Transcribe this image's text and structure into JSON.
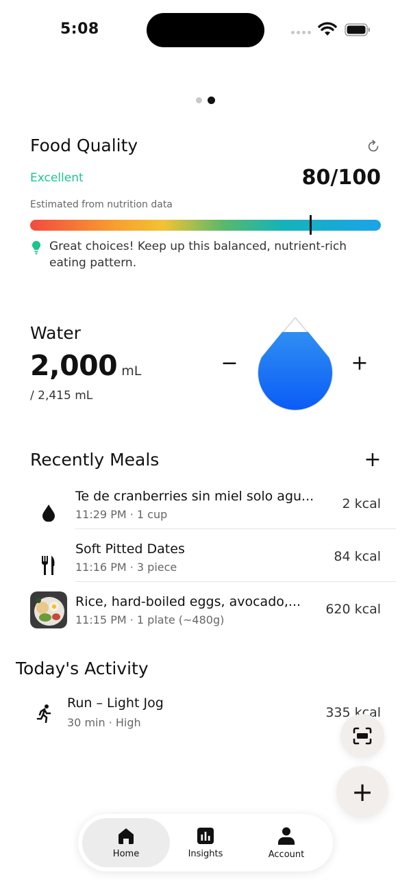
{
  "status": {
    "time": "5:08"
  },
  "food_quality": {
    "title": "Food Quality",
    "rating": "Excellent",
    "score": "80/100",
    "score_value": 80,
    "subtitle": "Estimated from nutrition data",
    "tip": "Great choices! Keep up this balanced, nutrient-rich eating pattern.",
    "rating_color": "#1bc58d"
  },
  "water": {
    "title": "Water",
    "amount": "2,000",
    "unit": "mL",
    "goal": "/ 2,415 mL",
    "decrease_label": "−",
    "increase_label": "+"
  },
  "meals": {
    "title": "Recently Meals",
    "add_label": "+",
    "items": [
      {
        "icon": "water-drop-icon",
        "name": "Te de cranberries sin miel solo agu...",
        "meta": "11:29 PM · 1 cup",
        "kcal": "2 kcal"
      },
      {
        "icon": "fork-knife-icon",
        "name": "Soft Pitted Dates",
        "meta": "11:16 PM · 3 piece",
        "kcal": "84 kcal"
      },
      {
        "icon": "meal-photo",
        "name": "Rice, hard-boiled eggs, avocado,...",
        "meta": "11:15 PM · 1 plate (~480g)",
        "kcal": "620 kcal"
      }
    ]
  },
  "activity": {
    "title": "Today's Activity",
    "items": [
      {
        "icon": "running-icon",
        "name": "Run – Light Jog",
        "meta": "30 min · High",
        "kcal": "335 kcal"
      }
    ]
  },
  "fabs": {
    "add_label": "+"
  },
  "tabbar": {
    "tabs": [
      {
        "label": "Home",
        "icon": "home-icon",
        "active": true
      },
      {
        "label": "Insights",
        "icon": "chart-icon",
        "active": false
      },
      {
        "label": "Account",
        "icon": "person-icon",
        "active": false
      }
    ]
  },
  "colors": {
    "accent": "#1bc58d",
    "water": "#1a73f5"
  }
}
